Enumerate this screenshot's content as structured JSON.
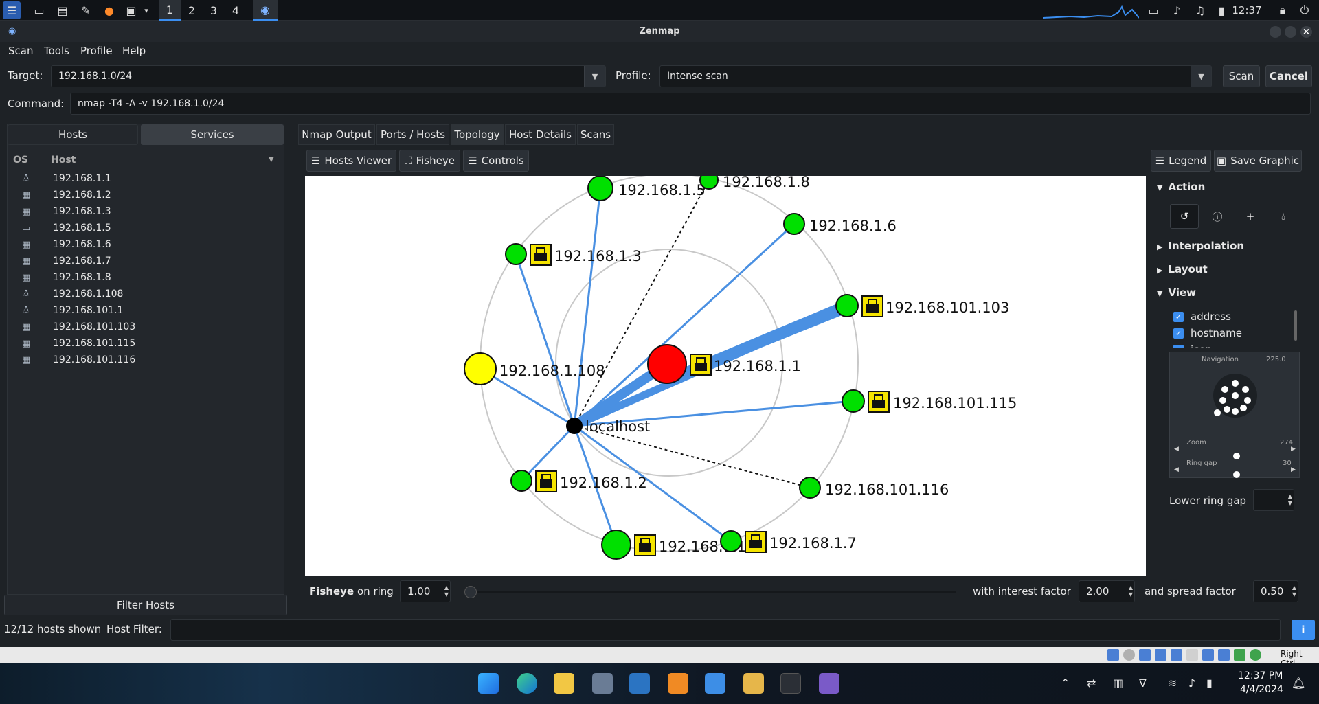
{
  "topbar": {
    "workspaces": [
      "1",
      "2",
      "3",
      "4"
    ],
    "clock": "12:37"
  },
  "window": {
    "title": "Zenmap"
  },
  "menu": [
    "Scan",
    "Tools",
    "Profile",
    "Help"
  ],
  "target": {
    "label": "Target:",
    "value": "192.168.1.0/24"
  },
  "profile": {
    "label": "Profile:",
    "value": "Intense scan"
  },
  "buttons": {
    "scan": "Scan",
    "cancel": "Cancel"
  },
  "command": {
    "label": "Command:",
    "value": "nmap -T4 -A -v 192.168.1.0/24"
  },
  "left": {
    "tabs": [
      "Hosts",
      "Services"
    ],
    "columns": {
      "os": "OS",
      "host": "Host"
    },
    "hosts": [
      {
        "ip": "192.168.1.1",
        "os": "linux"
      },
      {
        "ip": "192.168.1.2",
        "os": "windows"
      },
      {
        "ip": "192.168.1.3",
        "os": "windows"
      },
      {
        "ip": "192.168.1.5",
        "os": "unknown"
      },
      {
        "ip": "192.168.1.6",
        "os": "windows"
      },
      {
        "ip": "192.168.1.7",
        "os": "windows"
      },
      {
        "ip": "192.168.1.8",
        "os": "windows"
      },
      {
        "ip": "192.168.1.108",
        "os": "linux"
      },
      {
        "ip": "192.168.101.1",
        "os": "linux"
      },
      {
        "ip": "192.168.101.103",
        "os": "windows"
      },
      {
        "ip": "192.168.101.115",
        "os": "windows"
      },
      {
        "ip": "192.168.101.116",
        "os": "windows"
      }
    ],
    "filter_button": "Filter Hosts"
  },
  "status": {
    "shown": "12/12 hosts shown",
    "filter_label": "Host Filter:"
  },
  "tabs": [
    "Nmap Output",
    "Ports / Hosts",
    "Topology",
    "Host Details",
    "Scans"
  ],
  "toolbar": {
    "hosts_viewer": "Hosts Viewer",
    "fisheye": "Fisheye",
    "controls": "Controls",
    "legend": "Legend",
    "save_graphic": "Save Graphic"
  },
  "topology": {
    "center_label": "localhost",
    "nodes": [
      {
        "label": "192.168.1.5",
        "color": "#00e000"
      },
      {
        "label": "192.168.1.8",
        "color": "#00e000"
      },
      {
        "label": "192.168.1.6",
        "color": "#00e000"
      },
      {
        "label": "192.168.1.3",
        "color": "#00e000"
      },
      {
        "label": "192.168.101.103",
        "color": "#00e000"
      },
      {
        "label": "192.168.1.108",
        "color": "#ffff00"
      },
      {
        "label": "192.168.1.1",
        "color": "#ff0000"
      },
      {
        "label": "192.168.101.115",
        "color": "#00e000"
      },
      {
        "label": "192.168.1.2",
        "color": "#00e000"
      },
      {
        "label": "192.168.101.116",
        "color": "#00e000"
      },
      {
        "label": "192.168.1.10",
        "color": "#00e000"
      },
      {
        "label": "192.168.1.7",
        "color": "#00e000"
      }
    ]
  },
  "controls": {
    "action": "Action",
    "interpolation": "Interpolation",
    "layout": "Layout",
    "view": "View",
    "view_items": [
      "address",
      "hostname",
      "icon"
    ],
    "navigation_label": "Navigation",
    "navigation_value": "225.0",
    "zoom_label": "Zoom",
    "zoom_value": "274",
    "ring_gap_label": "Ring gap",
    "ring_gap_value": "30",
    "lower_ring_gap": "Lower ring gap"
  },
  "fisheye": {
    "label": "Fisheye",
    "on_ring": "on ring",
    "ring_value": "1.00",
    "interest_label": "with interest factor",
    "interest_value": "2.00",
    "spread_label": "and spread factor",
    "spread_value": "0.50"
  },
  "vbox": {
    "hostkey": "Right Ctrl"
  },
  "taskbar": {
    "time": "12:37 PM",
    "date": "4/4/2024"
  }
}
